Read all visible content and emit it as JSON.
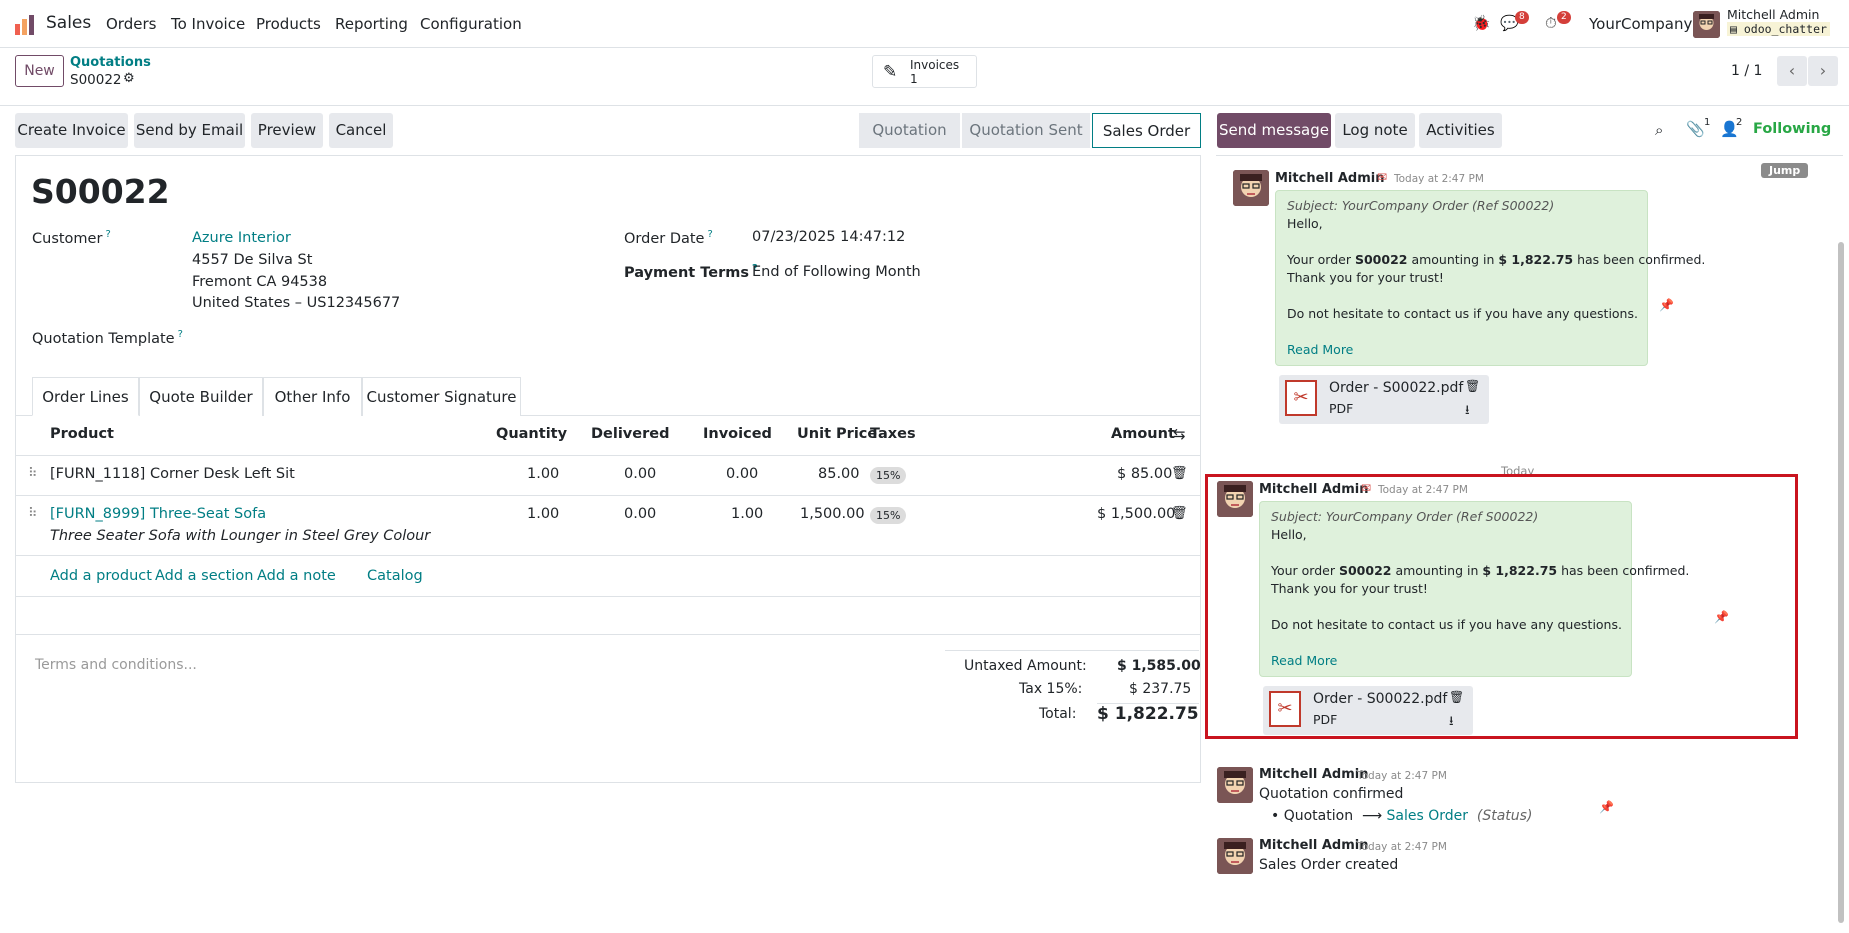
{
  "navbar": {
    "app_name": "Sales",
    "menu": [
      "Orders",
      "To Invoice",
      "Products",
      "Reporting",
      "Configuration"
    ],
    "messages_count": "8",
    "activities_count": "2",
    "company": "YourCompany",
    "user_name": "Mitchell Admin",
    "db_name": "odoo_chatter"
  },
  "control_panel": {
    "new_label": "New",
    "breadcrumb_parent": "Quotations",
    "breadcrumb_current": "S00022",
    "invoices_label": "Invoices",
    "invoices_count": "1",
    "pager": "1 / 1"
  },
  "actions": {
    "create_invoice": "Create Invoice",
    "send_email": "Send by Email",
    "preview": "Preview",
    "cancel": "Cancel"
  },
  "status_stages": [
    "Quotation",
    "Quotation Sent",
    "Sales Order"
  ],
  "form": {
    "name": "S00022",
    "customer_label": "Customer",
    "customer_name": "Azure Interior",
    "address_line1": "4557 De Silva St",
    "address_line2": "Fremont CA 94538",
    "address_line3": "United States – US12345677",
    "template_label": "Quotation Template",
    "order_date_label": "Order Date",
    "order_date": "07/23/2025 14:47:12",
    "payment_terms_label": "Payment Terms",
    "payment_terms": "End of Following Month",
    "qmark": "?"
  },
  "tabs": [
    "Order Lines",
    "Quote Builder",
    "Other Info",
    "Customer Signature"
  ],
  "lines": {
    "headers": {
      "product": "Product",
      "quantity": "Quantity",
      "delivered": "Delivered",
      "invoiced": "Invoiced",
      "unit_price": "Unit Price",
      "taxes": "Taxes",
      "amount": "Amount"
    },
    "rows": [
      {
        "product": "[FURN_1118] Corner Desk Left Sit",
        "description": "",
        "quantity": "1.00",
        "delivered": "0.00",
        "invoiced": "0.00",
        "unit_price": "85.00",
        "tax": "15%",
        "amount": "$ 85.00"
      },
      {
        "product": "[FURN_8999] Three-Seat Sofa",
        "description": "Three Seater Sofa with Lounger in Steel Grey Colour",
        "quantity": "1.00",
        "delivered": "0.00",
        "invoiced": "1.00",
        "unit_price": "1,500.00",
        "tax": "15%",
        "amount": "$ 1,500.00"
      }
    ],
    "add_product": "Add a product",
    "add_section": "Add a section",
    "add_note": "Add a note",
    "catalog": "Catalog"
  },
  "totals": {
    "terms_placeholder": "Terms and conditions...",
    "untaxed_label": "Untaxed Amount:",
    "untaxed_value": "$ 1,585.00",
    "tax_label": "Tax 15%:",
    "tax_value": "$ 237.75",
    "total_label": "Total:",
    "total_value": "$ 1,822.75"
  },
  "chatter": {
    "send_message": "Send message",
    "log_note": "Log note",
    "activities": "Activities",
    "attachments_count": "1",
    "followers_count": "2",
    "following": "Following",
    "jump": "Jump",
    "today_separator": "Today",
    "messages": [
      {
        "author": "Mitchell Admin",
        "time": "Today at 2:47 PM",
        "subject": "Subject: YourCompany Order (Ref S00022)",
        "greeting": "Hello,",
        "body_pre": "Your order ",
        "body_order": "S00022",
        "body_mid": " amounting in ",
        "body_amount": "$ 1,822.75",
        "body_post": " has been confirmed.",
        "thanks": "Thank you for your trust!",
        "contact": "Do not hesitate to contact us if you have any questions.",
        "read_more": "Read More",
        "attachment_name": "Order - S00022.pdf",
        "attachment_type": "PDF"
      },
      {
        "author": "Mitchell Admin",
        "time": "Today at 2:47 PM",
        "subject": "Subject: YourCompany Order (Ref S00022)",
        "greeting": "Hello,",
        "body_pre": "Your order ",
        "body_order": "S00022",
        "body_mid": " amounting in ",
        "body_amount": "$ 1,822.75",
        "body_post": " has been confirmed.",
        "thanks": "Thank you for your trust!",
        "contact": "Do not hesitate to contact us if you have any questions.",
        "read_more": "Read More",
        "attachment_name": "Order - S00022.pdf",
        "attachment_type": "PDF"
      },
      {
        "author": "Mitchell Admin",
        "time": "Today at 2:47 PM",
        "text": "Quotation confirmed",
        "change_old": "Quotation",
        "change_new": "Sales Order",
        "change_field": "(Status)"
      },
      {
        "author": "Mitchell Admin",
        "time": "Today at 2:47 PM",
        "text": "Sales Order created"
      }
    ]
  },
  "colors": {
    "brand": "#714b67",
    "link": "#017e84",
    "highlight_border": "#c9141f",
    "following": "#28a745"
  }
}
